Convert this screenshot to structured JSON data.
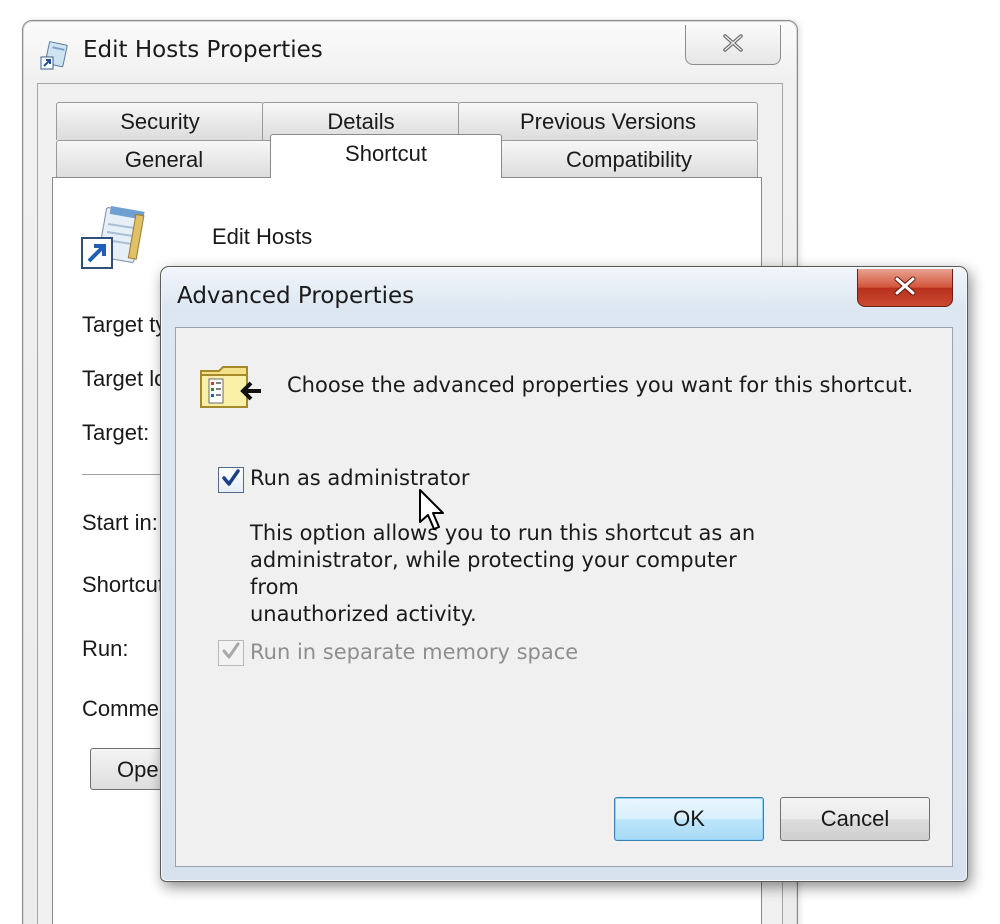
{
  "back_window": {
    "title": "Edit Hosts Properties",
    "tabs_row1": [
      "Security",
      "Details",
      "Previous Versions"
    ],
    "tabs_row2": [
      "General",
      "Shortcut",
      "Compatibility"
    ],
    "active_tab": "Shortcut",
    "shortcut_name": "Edit Hosts",
    "labels": {
      "target_type": "Target ty",
      "target_location": "Target lo",
      "target": "Target:",
      "start_in": "Start in:",
      "shortcut_key": "Shortcut",
      "run": "Run:",
      "comment": "Commen"
    },
    "open_button": "Ope"
  },
  "dialog": {
    "title": "Advanced Properties",
    "heading": "Choose the advanced properties you want for this shortcut.",
    "run_as_admin": {
      "label": "Run as administrator",
      "checked": true
    },
    "description_lines": [
      "This option allows you to run this shortcut as an",
      "administrator, while protecting your computer from",
      "unauthorized activity."
    ],
    "separate_memory": {
      "label": "Run in separate memory space",
      "checked": true,
      "disabled": true
    },
    "ok_label": "OK",
    "cancel_label": "Cancel"
  },
  "icons": {
    "back_title": "shortcut-icon",
    "back_close": "close-icon",
    "dialog_close": "close-icon",
    "dialog_heading": "folder-properties-icon",
    "shortcut_large": "notepad-shortcut-icon",
    "cursor": "mouse-pointer-icon"
  },
  "colors": {
    "dialog_close": "#c94a2e",
    "default_button": "#bee6fd",
    "checkbox_border": "#4f6a8a"
  }
}
